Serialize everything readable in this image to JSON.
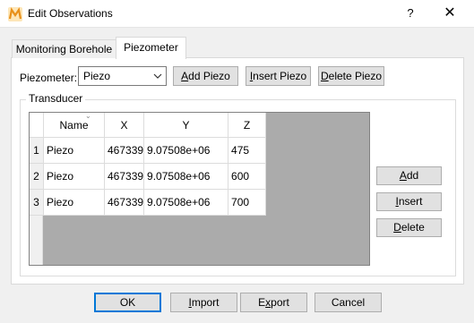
{
  "window": {
    "title": "Edit Observations",
    "help": "?",
    "close": "✕"
  },
  "tabs": [
    {
      "label": "Monitoring Borehole",
      "active": false
    },
    {
      "label": "Piezometer",
      "active": true
    }
  ],
  "piezometer": {
    "label": "Piezometer:",
    "selected": "Piezo",
    "add_label_pre": "",
    "add_label_u": "A",
    "add_label_post": "dd Piezo",
    "insert_label_pre": "",
    "insert_label_u": "I",
    "insert_label_post": "nsert Piezo",
    "delete_label_pre": "",
    "delete_label_u": "D",
    "delete_label_post": "elete Piezo"
  },
  "transducer": {
    "group_label": "Transducer",
    "columns": [
      "Name",
      "X",
      "Y",
      "Z"
    ],
    "rows": [
      {
        "num": "1",
        "name": "Piezo",
        "x": "467339",
        "y": "9.07508e+06",
        "z": "475"
      },
      {
        "num": "2",
        "name": "Piezo",
        "x": "467339",
        "y": "9.07508e+06",
        "z": "600"
      },
      {
        "num": "3",
        "name": "Piezo",
        "x": "467339",
        "y": "9.07508e+06",
        "z": "700"
      }
    ],
    "add_pre": "",
    "add_u": "A",
    "add_post": "dd",
    "insert_pre": "",
    "insert_u": "I",
    "insert_post": "nsert",
    "delete_pre": "",
    "delete_u": "D",
    "delete_post": "elete"
  },
  "footer": {
    "ok": "OK",
    "import_u": "I",
    "import_post": "mport",
    "export_pre": "E",
    "export_u": "x",
    "export_post": "port",
    "cancel": "Cancel"
  },
  "colors": {
    "accent": "#0078d7",
    "logo_orange": "#f0a030"
  }
}
